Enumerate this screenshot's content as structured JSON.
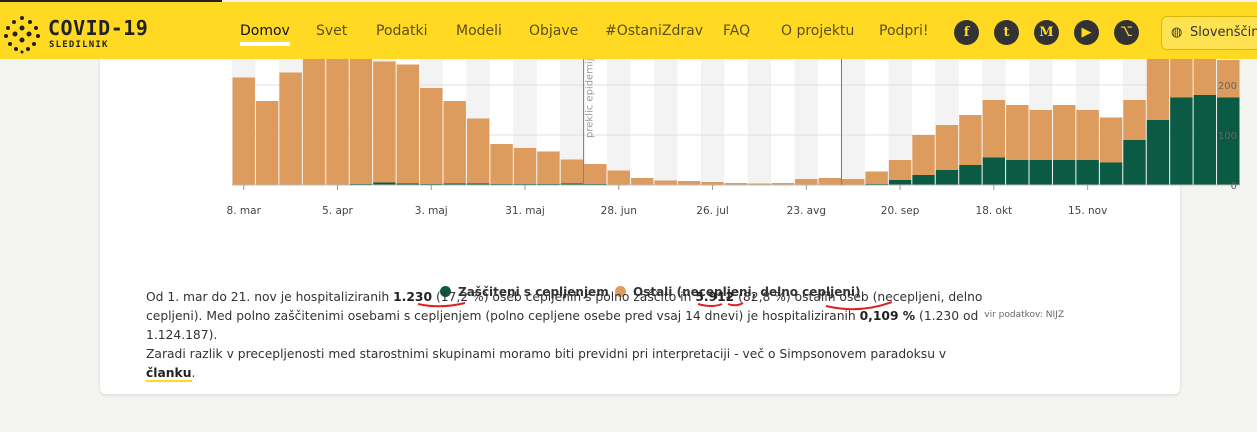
{
  "header": {
    "logo_title": "COVID-19",
    "logo_subtitle": "SLEDILNIK",
    "nav": [
      "Domov",
      "Svet",
      "Podatki",
      "Modeli",
      "Objave",
      "#OstaniZdrav",
      "FAQ",
      "O projektu",
      "Podpri!"
    ],
    "active_nav": "Domov",
    "social_icons": [
      "facebook-icon",
      "twitter-icon",
      "medium-icon",
      "youtube-icon",
      "github-icon"
    ],
    "language": "Slovenščina",
    "accent_color": "#ffd922"
  },
  "chart_data": {
    "type": "bar",
    "stacked": true,
    "x_tick_labels": [
      "8. mar",
      "5. apr",
      "3. maj",
      "31. maj",
      "28. jun",
      "26. jul",
      "23. avg",
      "20. sep",
      "18. okt",
      "15. nov"
    ],
    "y_tick_labels": [
      "0",
      "100",
      "200"
    ],
    "ylim": [
      0,
      260
    ],
    "grid": true,
    "annotation": "preklic epidemije",
    "series": [
      {
        "name": "Zaščiteni s cepljenjem",
        "color": "#0a5a44",
        "values": [
          0,
          0,
          0,
          0,
          0,
          2,
          5,
          3,
          2,
          3,
          3,
          2,
          2,
          2,
          3,
          2,
          1,
          1,
          0,
          0,
          0,
          0,
          0,
          0,
          0,
          0,
          0,
          2,
          10,
          20,
          30,
          40,
          55,
          50,
          50,
          50,
          50,
          45,
          90,
          130,
          175,
          180,
          175
        ]
      },
      {
        "name": "Ostali (necepljeni, delno cepljeni)",
        "color": "#dd9b5e",
        "values": [
          215,
          168,
          225,
          262,
          268,
          262,
          242,
          238,
          192,
          165,
          130,
          80,
          72,
          65,
          48,
          40,
          28,
          13,
          9,
          8,
          6,
          4,
          3,
          4,
          12,
          14,
          12,
          25,
          40,
          80,
          90,
          100,
          115,
          110,
          100,
          110,
          100,
          90,
          80,
          130,
          85,
          80,
          75
        ]
      }
    ]
  },
  "legend": {
    "protected": "Zaščiteni s cepljenjem",
    "others": "Ostali (necepljeni, delno cepljeni)"
  },
  "source": "vir podatkov: NIJZ",
  "paragraph": {
    "p1a": "Od 1. mar do 21. nov je hospitaliziranih ",
    "n1": "1.230",
    "p1b": " (17,2 %) oseb cepljenih s polno zaščito in ",
    "n2": "5.912",
    "p1c": " (82,8 %) ostalih oseb (necepljeni, delno cepljeni). Med polno zaščitenimi osebami s cepljenjem (polno cepljene osebe pred vsaj 14 dnevi) je hospitaliziranih ",
    "n3": "0,109 %",
    "p1d": " (1.230 od 1.124.187).",
    "p2a": "Zaradi razlik v precepljenosti med starostnimi skupinami moramo biti previdni pri interpretaciji - več o Simpsonovem paradoksu v ",
    "link": "članku",
    "p2b": "."
  }
}
